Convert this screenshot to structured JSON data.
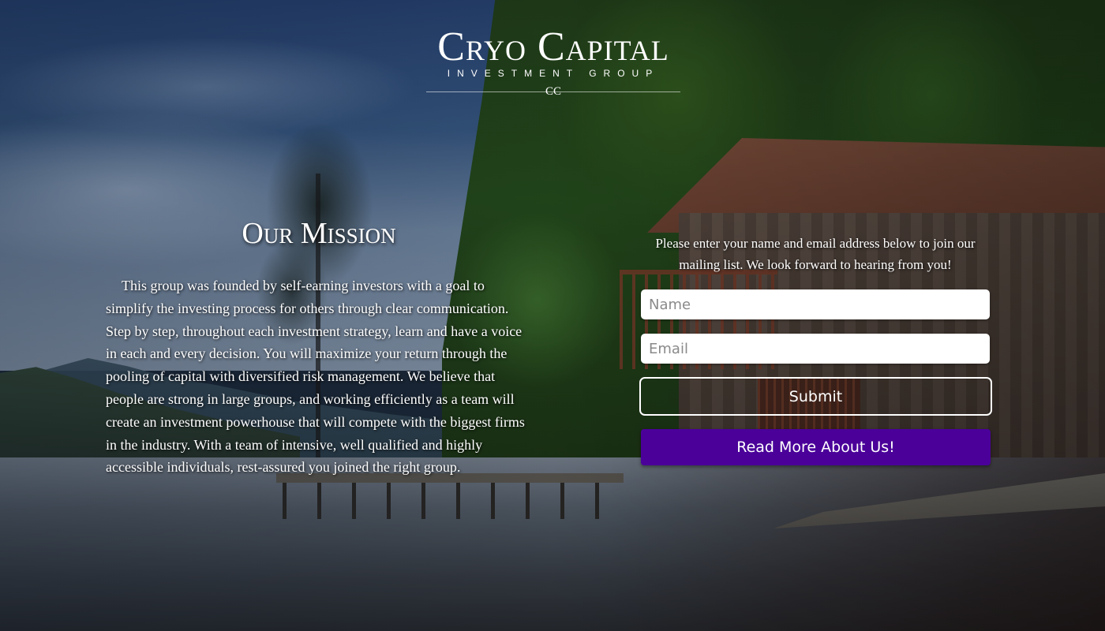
{
  "logo": {
    "title": "Cryo Capital",
    "subtitle": "INVESTMENT GROUP",
    "mark": "CC"
  },
  "mission": {
    "title": "Our Mission",
    "body": "This group was founded by self-earning investors with a goal to simplify the investing process for others through clear communication. Step by step, throughout each investment strategy, learn and have a voice in each and every decision. You will maximize your return through the pooling of capital with diversified risk management. We believe that people are strong in large groups, and working efficiently as a team will create an investment powerhouse that will compete with the biggest firms in the industry. With a team of intensive, well qualified and highly accessible individuals, rest-assured you joined the right group."
  },
  "signup": {
    "prompt": "Please enter your name and email address below to join our mailing list. We look forward to hearing from you!",
    "name_placeholder": "Name",
    "email_placeholder": "Email",
    "name_value": "",
    "email_value": "",
    "submit_label": "Submit"
  },
  "read_more": {
    "label": "Read More About Us!"
  },
  "colors": {
    "accent_purple": "#4a0099",
    "text": "#ffffff"
  }
}
